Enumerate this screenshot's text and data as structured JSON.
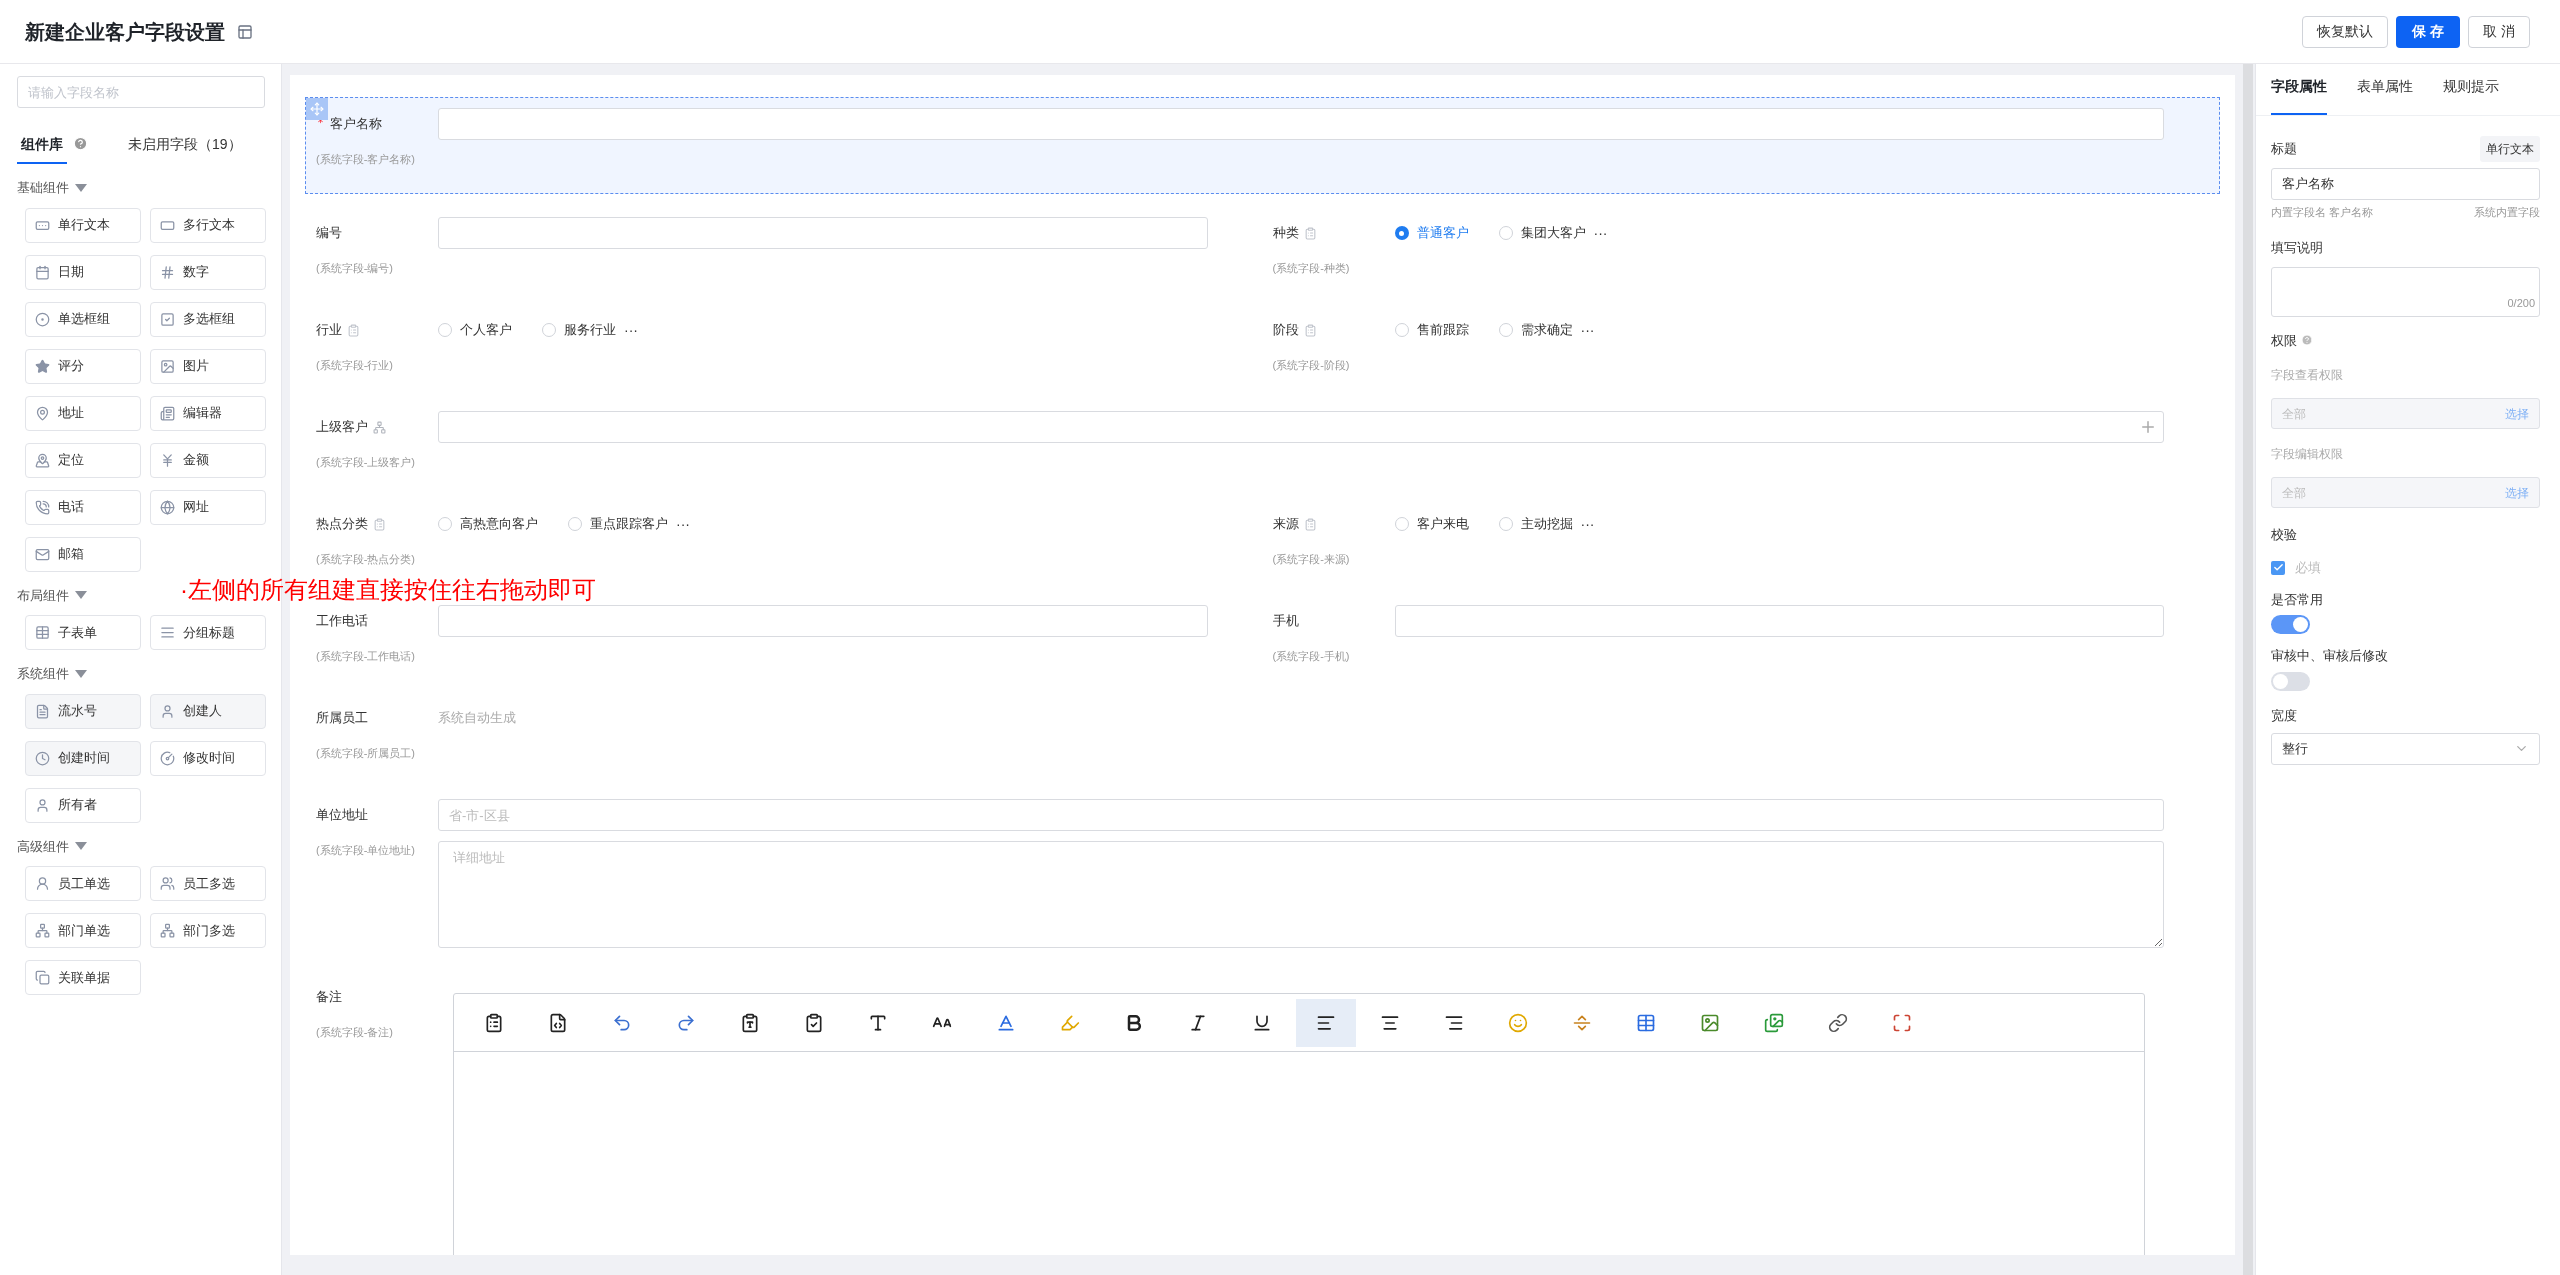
{
  "header": {
    "title": "新建企业客户字段设置",
    "buttons": [
      {
        "label": "恢复默认",
        "kind": "default"
      },
      {
        "label": "保 存",
        "kind": "primary"
      },
      {
        "label": "取 消",
        "kind": "default"
      }
    ]
  },
  "sidebar": {
    "search_placeholder": "请输入字段名称",
    "tabs": [
      {
        "label": "组件库",
        "selected": true,
        "help": true
      },
      {
        "label": "未启用字段（19）",
        "selected": false,
        "help": false
      }
    ],
    "groups": [
      {
        "title": "基础组件",
        "expanded": true,
        "items": [
          {
            "label": "单行文本",
            "kind": "single-line",
            "disabled": false
          },
          {
            "label": "多行文本",
            "kind": "multi-line",
            "disabled": false
          },
          {
            "label": "日期",
            "kind": "date",
            "disabled": false
          },
          {
            "label": "数字",
            "kind": "number",
            "disabled": false
          },
          {
            "label": "单选框组",
            "kind": "radio",
            "disabled": false
          },
          {
            "label": "多选框组",
            "kind": "checkbox",
            "disabled": false
          },
          {
            "label": "评分",
            "kind": "rating",
            "disabled": false
          },
          {
            "label": "图片",
            "kind": "image",
            "disabled": false
          },
          {
            "label": "地址",
            "kind": "address",
            "disabled": false
          },
          {
            "label": "编辑器",
            "kind": "editor",
            "disabled": false
          },
          {
            "label": "定位",
            "kind": "location",
            "disabled": false
          },
          {
            "label": "金额",
            "kind": "money",
            "disabled": false
          },
          {
            "label": "电话",
            "kind": "phone",
            "disabled": false
          },
          {
            "label": "网址",
            "kind": "url",
            "disabled": false
          },
          {
            "label": "邮箱",
            "kind": "mail",
            "disabled": false
          }
        ]
      },
      {
        "title": "布局组件",
        "expanded": true,
        "items": [
          {
            "label": "子表单",
            "kind": "table",
            "disabled": false
          },
          {
            "label": "分组标题",
            "kind": "group-title",
            "disabled": false
          }
        ]
      },
      {
        "title": "系统组件",
        "expanded": true,
        "items": [
          {
            "label": "流水号",
            "kind": "serial",
            "disabled": true
          },
          {
            "label": "创建人",
            "kind": "user",
            "disabled": true
          },
          {
            "label": "创建时间",
            "kind": "clock",
            "disabled": true
          },
          {
            "label": "修改时间",
            "kind": "gauge",
            "disabled": false
          },
          {
            "label": "所有者",
            "kind": "user",
            "disabled": false
          }
        ]
      },
      {
        "title": "高级组件",
        "expanded": true,
        "items": [
          {
            "label": "员工单选",
            "kind": "user-single",
            "disabled": false
          },
          {
            "label": "员工多选",
            "kind": "users",
            "disabled": false
          },
          {
            "label": "部门单选",
            "kind": "dept",
            "disabled": false
          },
          {
            "label": "部门多选",
            "kind": "dept",
            "disabled": false
          },
          {
            "label": "关联单据",
            "kind": "link-doc",
            "disabled": false
          }
        ]
      }
    ]
  },
  "annotation": "·左侧的所有组建直接按住往右拖动即可",
  "form": {
    "rows": [
      {
        "fields": [
          {
            "label": "客户名称",
            "note": "(系统字段-客户名称)",
            "kind": "text",
            "required": true,
            "selected": true
          }
        ]
      },
      {
        "fields": [
          {
            "label": "编号",
            "note": "(系统字段-编号)",
            "kind": "text",
            "required": false,
            "selected": false
          },
          {
            "label": "种类",
            "note": "(系统字段-种类)",
            "kind": "radio",
            "required": false,
            "selected": false,
            "more": "···",
            "options": [
              {
                "label": "普通客户",
                "selected": true
              },
              {
                "label": "集团大客户",
                "selected": false
              }
            ]
          }
        ]
      },
      {
        "fields": [
          {
            "label": "行业",
            "note": "(系统字段-行业)",
            "kind": "radio",
            "required": false,
            "selected": false,
            "more": "···",
            "options": [
              {
                "label": "个人客户",
                "selected": false
              },
              {
                "label": "服务行业",
                "selected": false
              }
            ]
          },
          {
            "label": "阶段",
            "note": "(系统字段-阶段)",
            "kind": "radio",
            "required": false,
            "selected": false,
            "more": "···",
            "options": [
              {
                "label": "售前跟踪",
                "selected": false
              },
              {
                "label": "需求确定",
                "selected": false
              }
            ]
          }
        ]
      },
      {
        "fields": [
          {
            "label": "上级客户",
            "note": "(系统字段-上级客户)",
            "kind": "lookup",
            "required": false,
            "selected": false
          }
        ]
      },
      {
        "fields": [
          {
            "label": "热点分类",
            "note": "(系统字段-热点分类)",
            "kind": "radio",
            "required": false,
            "selected": false,
            "more": "···",
            "options": [
              {
                "label": "高热意向客户",
                "selected": false
              },
              {
                "label": "重点跟踪客户",
                "selected": false
              }
            ]
          },
          {
            "label": "来源",
            "note": "(系统字段-来源)",
            "kind": "radio",
            "required": false,
            "selected": false,
            "more": "···",
            "options": [
              {
                "label": "客户来电",
                "selected": false
              },
              {
                "label": "主动挖掘",
                "selected": false
              }
            ]
          }
        ]
      },
      {
        "fields": [
          {
            "label": "工作电话",
            "note": "(系统字段-工作电话)",
            "kind": "text",
            "required": false,
            "selected": false
          },
          {
            "label": "手机",
            "note": "(系统字段-手机)",
            "kind": "text",
            "required": false,
            "selected": false
          }
        ]
      },
      {
        "fields": [
          {
            "label": "所属员工",
            "note": "(系统字段-所属员工)",
            "kind": "static",
            "value": "系统自动生成",
            "required": false,
            "selected": false
          }
        ]
      },
      {
        "fields": [
          {
            "label": "单位地址",
            "note": "(系统字段-单位地址)",
            "kind": "address",
            "region_placeholder": "省-市-区县",
            "detail_placeholder": "详细地址",
            "required": false,
            "selected": false
          }
        ]
      },
      {
        "fields": [
          {
            "label": "备注",
            "note": "(系统字段-备注)",
            "kind": "editor",
            "required": false,
            "selected": false,
            "toolbar": [
              {
                "kind": "paste-text",
                "selected": false
              },
              {
                "kind": "source",
                "selected": false
              },
              {
                "kind": "undo",
                "selected": false
              },
              {
                "kind": "redo",
                "selected": false
              },
              {
                "kind": "paste-plain",
                "selected": false
              },
              {
                "kind": "paste-word",
                "selected": false
              },
              {
                "kind": "font-family",
                "selected": false
              },
              {
                "kind": "font-size",
                "selected": false
              },
              {
                "kind": "font-color",
                "selected": false
              },
              {
                "kind": "highlight",
                "selected": false
              },
              {
                "kind": "bold",
                "selected": false
              },
              {
                "kind": "italic",
                "selected": false
              },
              {
                "kind": "underline",
                "selected": false
              },
              {
                "kind": "align-left",
                "selected": true
              },
              {
                "kind": "align-center",
                "selected": false
              },
              {
                "kind": "align-right",
                "selected": false
              },
              {
                "kind": "emoji",
                "selected": false
              },
              {
                "kind": "rule",
                "selected": false
              },
              {
                "kind": "table",
                "selected": false
              },
              {
                "kind": "image",
                "selected": false
              },
              {
                "kind": "images",
                "selected": false
              },
              {
                "kind": "link",
                "selected": false
              },
              {
                "kind": "fullscreen",
                "selected": false
              }
            ]
          }
        ]
      }
    ]
  },
  "properties": {
    "tabs": [
      {
        "label": "字段属性",
        "selected": true
      },
      {
        "label": "表单属性",
        "selected": false
      },
      {
        "label": "规则提示",
        "selected": false
      }
    ],
    "title_label": "标题",
    "type_badge": "单行文本",
    "title_value": "客户名称",
    "builtin_name": "内置字段名 客户名称",
    "builtin_note": "系统内置字段",
    "description_label": "填写说明",
    "description_counter": "0/200",
    "permission_label": "权限",
    "permissions": [
      {
        "label": "字段查看权限",
        "value": "全部",
        "action": "选择"
      },
      {
        "label": "字段编辑权限",
        "value": "全部",
        "action": "选择"
      }
    ],
    "validation_label": "校验",
    "required_option": {
      "label": "必填",
      "checked": true
    },
    "toggles": [
      {
        "label": "是否常用",
        "on": true
      },
      {
        "label": "审核中、审核后修改",
        "on": false
      }
    ],
    "width_label": "宽度",
    "width_value": "整行"
  }
}
